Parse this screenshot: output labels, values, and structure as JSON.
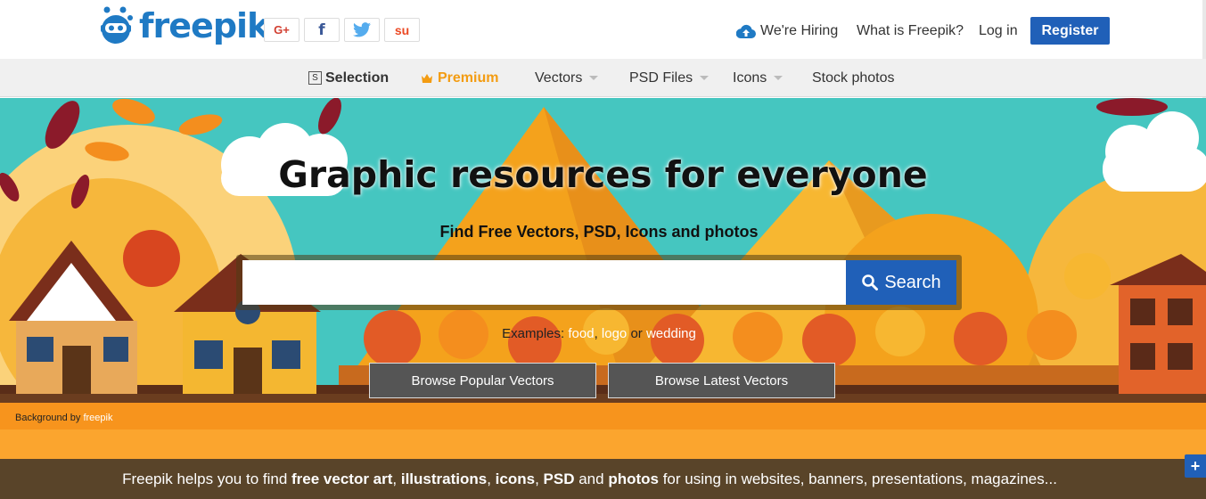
{
  "brand": {
    "name": "freepik"
  },
  "social": {
    "gplus": "G+",
    "facebook": "f",
    "stumble": "su"
  },
  "topnav": {
    "hiring": "We're Hiring",
    "what": "What is Freepik?",
    "login": "Log in",
    "register": "Register"
  },
  "catnav": {
    "selection_icon": "S",
    "items": [
      {
        "label": "Selection"
      },
      {
        "label": "Premium"
      },
      {
        "label": "Vectors"
      },
      {
        "label": "PSD Files"
      },
      {
        "label": "Icons"
      },
      {
        "label": "Stock photos"
      }
    ]
  },
  "hero": {
    "title": "Graphic resources for everyone",
    "subtitle": "Find Free Vectors, PSD, Icons and photos",
    "search": {
      "placeholder": "",
      "button": "Search"
    },
    "examples": {
      "prefix": "Examples:",
      "items": [
        "food",
        "logo",
        "wedding"
      ],
      "sep1": ",",
      "or": "or"
    },
    "browse_popular": "Browse Popular Vectors",
    "browse_latest": "Browse Latest Vectors",
    "credit": {
      "prefix": "Background by",
      "brand": "freepik"
    }
  },
  "footer": {
    "parts": [
      "Freepik helps you to find ",
      "free vector art",
      ", ",
      "illustrations",
      ", ",
      "icons",
      ", ",
      "PSD",
      " and ",
      "photos",
      " for using in websites, banners, presentations, magazines..."
    ]
  },
  "colors": {
    "brand_blue": "#2060b8",
    "premium": "#f39c12",
    "sky": "#45c6c0"
  },
  "icons": {
    "plus": "+"
  }
}
